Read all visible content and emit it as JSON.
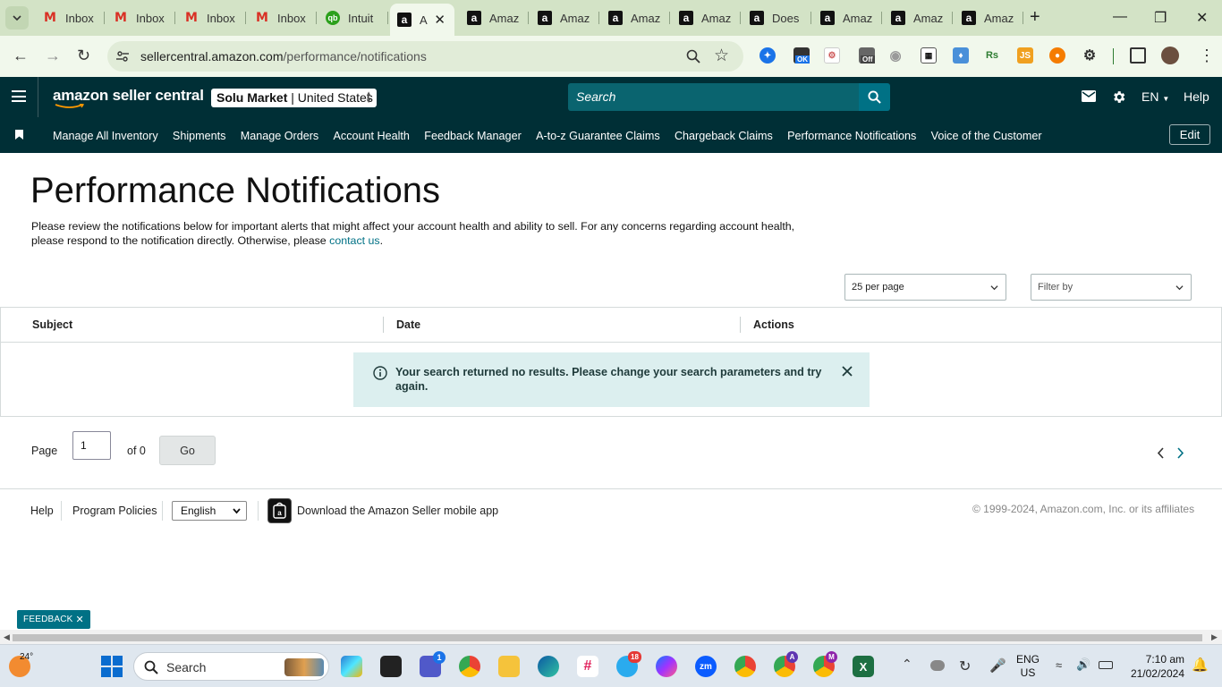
{
  "browser": {
    "tabs": [
      {
        "title": "Inbox",
        "icon": "gmail-icon"
      },
      {
        "title": "Inbox",
        "icon": "gmail-icon"
      },
      {
        "title": "Inbox",
        "icon": "gmail-icon"
      },
      {
        "title": "Inbox",
        "icon": "gmail-icon"
      },
      {
        "title": "Intuit",
        "icon": "quickbooks-icon"
      },
      {
        "title": "A",
        "icon": "amazon-icon",
        "active": true
      },
      {
        "title": "Amaz",
        "icon": "amazon-icon"
      },
      {
        "title": "Amaz",
        "icon": "amazon-icon"
      },
      {
        "title": "Amaz",
        "icon": "amazon-icon"
      },
      {
        "title": "Amaz",
        "icon": "amazon-icon"
      },
      {
        "title": "Does",
        "icon": "amazon-icon"
      },
      {
        "title": "Amaz",
        "icon": "amazon-icon"
      },
      {
        "title": "Amaz",
        "icon": "amazon-icon"
      },
      {
        "title": "Amaz",
        "icon": "amazon-icon"
      }
    ],
    "url_domain": "sellercentral.amazon.com",
    "url_path": "/performance/notifications",
    "ext_badge_ok": "OK",
    "ext_badge_off": "Off"
  },
  "header": {
    "logo_text": "amazon seller central",
    "store_name": "Solu Market",
    "store_region": "United States",
    "search_placeholder": "Search",
    "language": "EN",
    "help": "Help"
  },
  "nav": {
    "links": [
      "Manage All Inventory",
      "Shipments",
      "Manage Orders",
      "Account Health",
      "Feedback Manager",
      "A-to-z Guarantee Claims",
      "Chargeback Claims",
      "Performance Notifications",
      "Voice of the Customer"
    ],
    "edit": "Edit"
  },
  "page": {
    "title": "Performance Notifications",
    "intro": "Please review the notifications below for important alerts that might affect your account health and ability to sell. For any concerns regarding account health, please respond to the notification directly. Otherwise, please",
    "contact_link": "contact us",
    "per_page": "25 per page",
    "filter_placeholder": "Filter by",
    "columns": [
      "Subject",
      "Date",
      "Actions"
    ],
    "no_results": "Your search returned no results. Please change your search parameters and try again.",
    "pager": {
      "label": "Page",
      "value": "1",
      "of": "of 0",
      "go": "Go"
    }
  },
  "footer": {
    "help": "Help",
    "policies": "Program Policies",
    "language": "English",
    "app_download": "Download the Amazon Seller mobile app",
    "copyright": "© 1999-2024, Amazon.com, Inc. or its affiliates"
  },
  "feedback": "FEEDBACK",
  "taskbar": {
    "weather_temp": "24°",
    "search_label": "Search",
    "teams_badge": "1",
    "telegram_badge": "18",
    "chrome_profile_a": "A",
    "chrome_profile_m": "M",
    "zoom_label": "zm",
    "lang_line1": "ENG",
    "lang_line2": "US",
    "time": "7:10 am",
    "date": "21/02/2024"
  }
}
